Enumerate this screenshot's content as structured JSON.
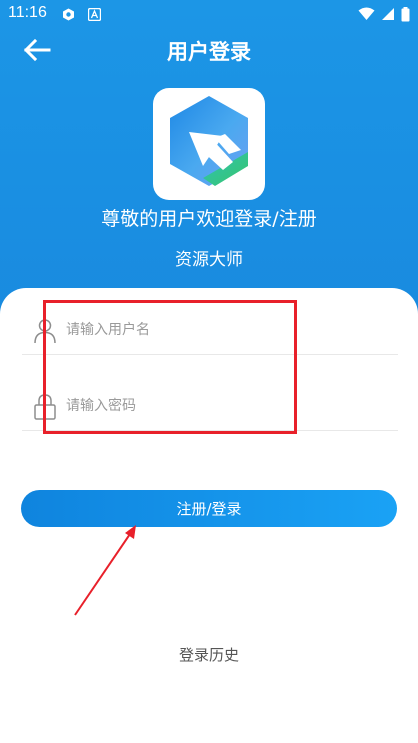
{
  "status_bar": {
    "time": "11:16",
    "icons": [
      "notification-icon",
      "a-badge-icon",
      "wifi-icon",
      "signal-icon",
      "battery-icon"
    ]
  },
  "header": {
    "title": "用户登录",
    "back_icon": "arrow-left-icon",
    "welcome": "尊敬的用户欢迎登录/注册",
    "app_name": "资源大师",
    "colors": {
      "primary": "#1a8fe2"
    }
  },
  "form": {
    "username": {
      "placeholder": "请输入用户名",
      "value": "",
      "icon": "user-icon"
    },
    "password": {
      "placeholder": "请输入密码",
      "value": "",
      "icon": "lock-icon"
    },
    "submit_label": "注册/登录"
  },
  "footer": {
    "history_label": "登录历史"
  },
  "annotation_color": "#e8202a"
}
